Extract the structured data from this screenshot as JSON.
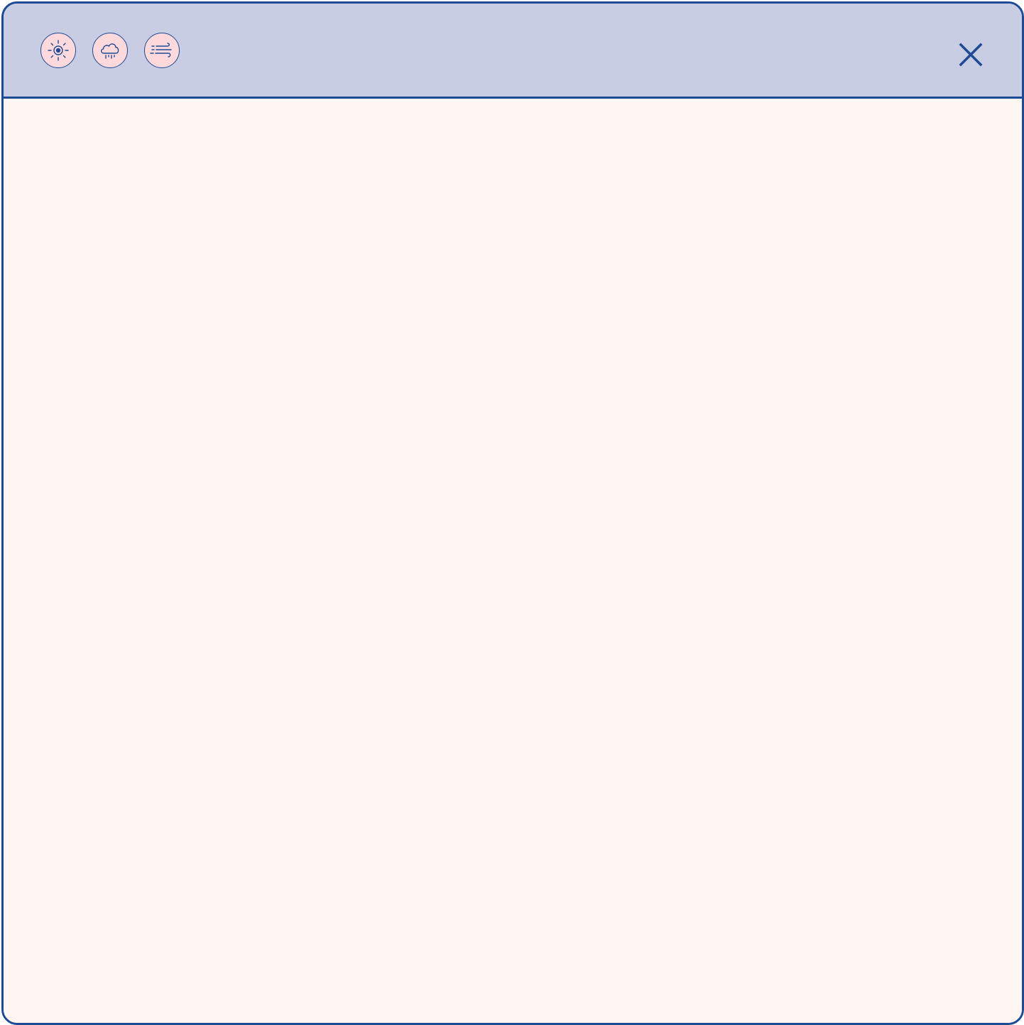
{
  "window": {
    "colors": {
      "border": "#1c4a94",
      "titlebar_bg": "#c8cde3",
      "content_bg": "#fff6f3",
      "icon_button_bg": "#ffd9dc",
      "icon_stroke": "#1c4a94"
    },
    "toolbar": {
      "buttons": [
        {
          "icon": "sun-icon"
        },
        {
          "icon": "rain-cloud-icon"
        },
        {
          "icon": "wind-icon"
        }
      ]
    },
    "close_button": {
      "icon": "close-icon"
    }
  }
}
